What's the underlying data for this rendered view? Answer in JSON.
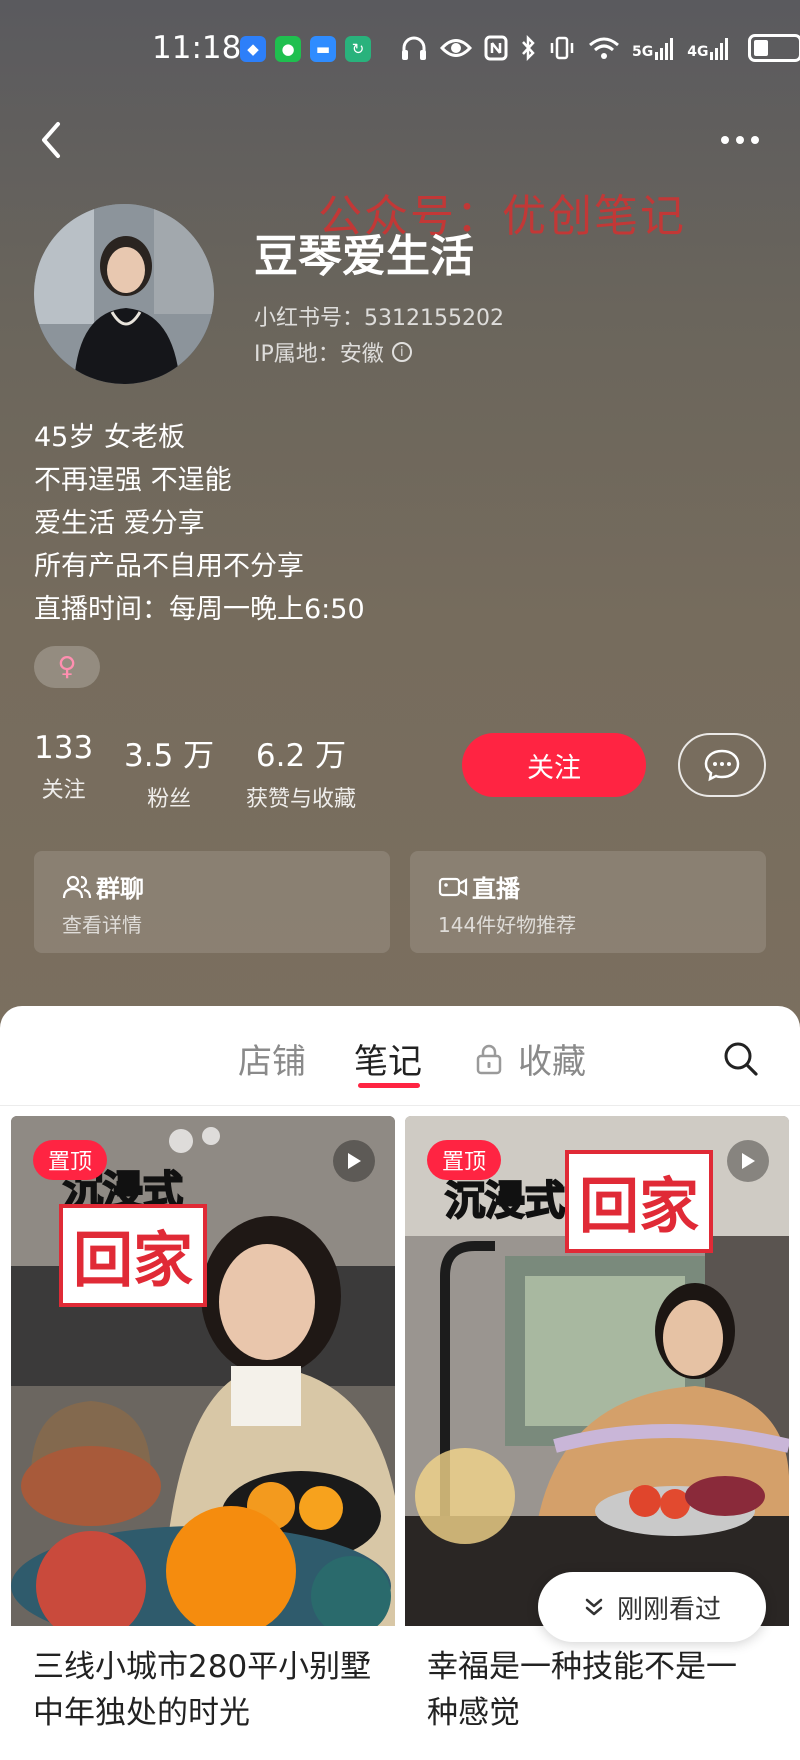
{
  "status_bar": {
    "time": "11:18",
    "network_5g": "5G",
    "network_4g": "4G"
  },
  "profile": {
    "watermark": "公众号：优创笔记",
    "nickname": "豆琴爱生活",
    "redbook_id": "小红书号：5312155202",
    "ip_location": "IP属地：安徽",
    "bio": [
      "45岁 女老板",
      "不再逞强 不逞能",
      "爱生活 爱分享",
      "所有产品不自用不分享",
      "直播时间：每周一晚上6:50"
    ],
    "gender_symbol": "♀",
    "stats": [
      {
        "num": "133",
        "label": "关注"
      },
      {
        "num": "3.5 万",
        "label": "粉丝"
      },
      {
        "num": "6.2 万",
        "label": "获赞与收藏"
      }
    ],
    "follow_label": "关注",
    "cards": [
      {
        "title": "群聊",
        "sub": "查看详情",
        "icon": "group-icon"
      },
      {
        "title": "直播",
        "sub": "144件好物推荐",
        "icon": "live-camera-icon"
      }
    ]
  },
  "tabs": [
    {
      "label": "店铺",
      "active": false
    },
    {
      "label": "笔记",
      "active": true
    },
    {
      "label": "收藏",
      "active": false,
      "icon": "lock-icon"
    }
  ],
  "notes": [
    {
      "pin": "置顶",
      "cover_text_1": "沉浸式",
      "cover_text_2": "回家",
      "title": "三线小城市280平小别墅中年独处的时光"
    },
    {
      "pin": "置顶",
      "cover_text_1": "沉浸式",
      "cover_text_2": "回家",
      "title": "幸福是一种技能不是一种感觉"
    }
  ],
  "recent_label": "刚刚看过",
  "colors": {
    "accent": "#ff2442",
    "header_bg": "#6f685c"
  }
}
